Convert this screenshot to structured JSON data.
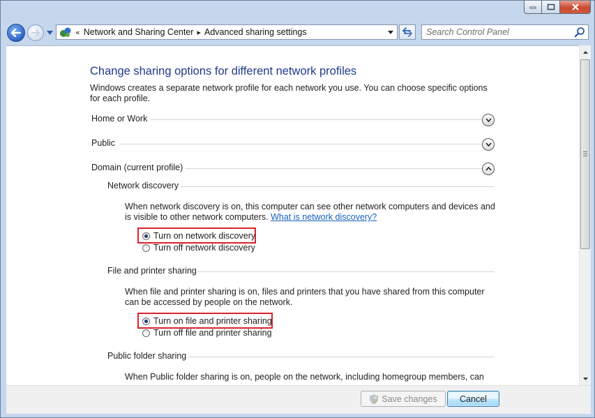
{
  "window": {
    "caption_buttons": [
      "minimize-icon",
      "maximize-icon",
      "close-icon"
    ]
  },
  "navigation": {
    "breadcrumb_prefix": "«",
    "breadcrumb": [
      "Network and Sharing Center",
      "Advanced sharing settings"
    ],
    "search_placeholder": "Search Control Panel"
  },
  "content": {
    "title": "Change sharing options for different network profiles",
    "intro": "Windows creates a separate network profile for each network you use. You can choose specific options for each profile.",
    "profiles": [
      {
        "label": "Home or Work",
        "expanded": false
      },
      {
        "label": "Public",
        "expanded": false
      },
      {
        "label": "Domain (current profile)",
        "expanded": true
      }
    ],
    "network_discovery": {
      "heading": "Network discovery",
      "description": "When network discovery is on, this computer can see other network computers and devices and is visible to other network computers.",
      "link": "What is network discovery?",
      "options": [
        {
          "label": "Turn on network discovery",
          "selected": true
        },
        {
          "label": "Turn off network discovery",
          "selected": false
        }
      ]
    },
    "file_printer_sharing": {
      "heading": "File and printer sharing",
      "description": "When file and printer sharing is on, files and printers that you have shared from this computer can be accessed by people on the network.",
      "options": [
        {
          "label": "Turn on file and printer sharing",
          "selected": true
        },
        {
          "label": "Turn off file and printer sharing",
          "selected": false
        }
      ]
    },
    "public_folder_sharing": {
      "heading": "Public folder sharing",
      "description": "When Public folder sharing is on, people on the network, including homegroup members, can"
    }
  },
  "footer": {
    "save_label": "Save changes",
    "cancel_label": "Cancel"
  },
  "colors": {
    "highlight_box": "#d9232d",
    "title": "#1e3a8a",
    "link": "#1560bd"
  }
}
